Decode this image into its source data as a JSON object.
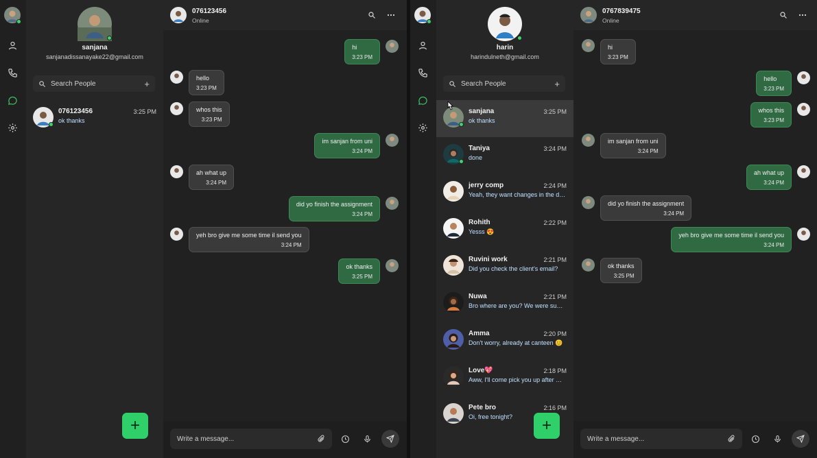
{
  "left": {
    "profile": {
      "name": "sanjana",
      "email": "sanjanadissanayake22@gmail.com"
    },
    "search": {
      "placeholder": "Search People",
      "add": "+"
    },
    "chats": [
      {
        "name": "076123456",
        "time": "3:25 PM",
        "last": "ok thanks",
        "online": true
      }
    ],
    "header": {
      "number": "076123456",
      "status": "Online"
    },
    "messages": [
      {
        "dir": "out",
        "text": "hi",
        "time": "3:23 PM"
      },
      {
        "dir": "in",
        "text": "hello",
        "time": "3:23 PM"
      },
      {
        "dir": "in",
        "text": "whos this",
        "time": "3:23 PM"
      },
      {
        "dir": "out",
        "text": "im sanjan from uni",
        "time": "3:24 PM"
      },
      {
        "dir": "in",
        "text": "ah what up",
        "time": "3:24 PM"
      },
      {
        "dir": "out",
        "text": "did yo finish the assignment",
        "time": "3:24 PM"
      },
      {
        "dir": "in",
        "text": "yeh bro give me some time il send you",
        "time": "3:24 PM"
      },
      {
        "dir": "out",
        "text": "ok thanks",
        "time": "3:25 PM"
      }
    ],
    "composer": {
      "placeholder": "Write a message..."
    },
    "fab": "+"
  },
  "right": {
    "profile": {
      "name": "harin",
      "email": "harindulneth@gmail.com"
    },
    "search": {
      "placeholder": "Search People",
      "add": "+"
    },
    "chats": [
      {
        "name": "sanjana",
        "time": "3:25 PM",
        "last": "ok thanks",
        "online": true
      },
      {
        "name": "Taniya",
        "time": "3:24 PM",
        "last": "done",
        "online": true
      },
      {
        "name": "jerry comp",
        "time": "2:24 PM",
        "last": "Yeah, they want changes in the design"
      },
      {
        "name": "Rohith",
        "time": "2:22 PM",
        "last": "Yesss 😍"
      },
      {
        "name": "Ruvini work",
        "time": "2:21 PM",
        "last": "Did you check the client's email?"
      },
      {
        "name": "Nuwa",
        "time": "2:21 PM",
        "last": "Bro where are you? We were supposed to"
      },
      {
        "name": "Amma",
        "time": "2:20 PM",
        "last": "Don't worry, already at canteen 😊"
      },
      {
        "name": "Love💖",
        "time": "2:18 PM",
        "last": "Aww, I'll come pick you up after work"
      },
      {
        "name": "Pete bro",
        "time": "2:16 PM",
        "last": "Oi, free tonight?"
      }
    ],
    "header": {
      "number": "0767839475",
      "status": "Online"
    },
    "messages": [
      {
        "dir": "in",
        "text": "hi",
        "time": "3:23 PM"
      },
      {
        "dir": "out",
        "text": "hello",
        "time": "3:23 PM"
      },
      {
        "dir": "out",
        "text": "whos this",
        "time": "3:23 PM"
      },
      {
        "dir": "in",
        "text": "im sanjan from uni",
        "time": "3:24 PM"
      },
      {
        "dir": "out",
        "text": "ah what up",
        "time": "3:24 PM"
      },
      {
        "dir": "in",
        "text": "did yo finish the assignment",
        "time": "3:24 PM"
      },
      {
        "dir": "out",
        "text": "yeh bro give me some time il send you",
        "time": "3:24 PM"
      },
      {
        "dir": "in",
        "text": "ok thanks",
        "time": "3:25 PM"
      }
    ],
    "composer": {
      "placeholder": "Write a message..."
    },
    "fab": "+"
  },
  "colors": {
    "accent": "#2fd06a",
    "outgoing": "#2f6a43",
    "incoming": "#3a3a3a",
    "background": "#212121",
    "online": "#3fd36b"
  },
  "icons": [
    "user-icon",
    "phone-icon",
    "chat-icon",
    "gear-icon",
    "search-icon",
    "more-icon",
    "attach-icon",
    "clock-icon",
    "mic-icon",
    "send-icon"
  ]
}
